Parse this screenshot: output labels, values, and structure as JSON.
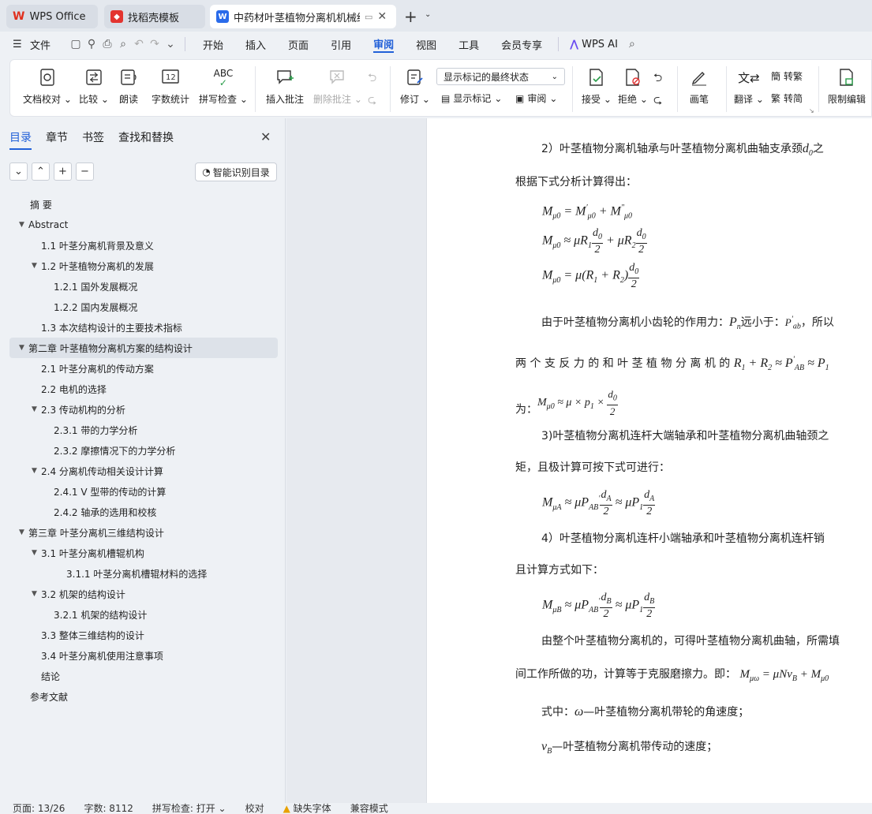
{
  "tabs": [
    {
      "label": "WPS Office"
    },
    {
      "label": "找稻壳模板"
    },
    {
      "label": "中药材叶茎植物分离机机械结构设计"
    }
  ],
  "menu": {
    "file": "文件",
    "items": [
      "开始",
      "插入",
      "页面",
      "引用",
      "审阅",
      "视图",
      "工具",
      "会员专享"
    ],
    "active": "审阅",
    "wps_ai": "WPS AI"
  },
  "ribbon": {
    "doc_proof": "文档校对",
    "compare": "比较",
    "read_aloud": "朗读",
    "word_count": "字数统计",
    "spell_check": "拼写检查",
    "insert_comment": "插入批注",
    "delete_comment": "删除批注",
    "track": "修订",
    "markup_dropdown": "显示标记的最终状态",
    "show_markup": "显示标记",
    "review": "审阅",
    "accept": "接受",
    "reject": "拒绝",
    "pen": "画笔",
    "translate": "翻译",
    "to_traditional": "转繁",
    "to_simplified": "转简",
    "restrict_edit": "限制编辑",
    "abc": "ABC",
    "num12": "12"
  },
  "nav": {
    "tabs": [
      "目录",
      "章节",
      "书签",
      "查找和替换"
    ],
    "smart_toc": "智能识别目录",
    "toc": [
      {
        "label": "摘 要",
        "level": 1,
        "tri": ""
      },
      {
        "label": "Abstract",
        "level": 1,
        "tri": "▼"
      },
      {
        "label": "1.1 叶茎分离机背景及意义",
        "level": 2,
        "tri": ""
      },
      {
        "label": "1.2  叶茎植物分离机的发展",
        "level": 2,
        "tri": "▼"
      },
      {
        "label": "1.2.1 国外发展概况",
        "level": 3,
        "tri": ""
      },
      {
        "label": "1.2.2 国内发展概况",
        "level": 3,
        "tri": ""
      },
      {
        "label": "1.3  本次结构设计的主要技术指标",
        "level": 2,
        "tri": ""
      },
      {
        "label": "第二章  叶茎植物分离机方案的结构设计",
        "level": 1,
        "tri": "▼",
        "selected": true
      },
      {
        "label": "2.1  叶茎分离机的传动方案",
        "level": 2,
        "tri": ""
      },
      {
        "label": "2.2 电机的选择",
        "level": 2,
        "tri": ""
      },
      {
        "label": "2.3 传动机构的分析",
        "level": 2,
        "tri": "▼"
      },
      {
        "label": "2.3.1 带的力学分析",
        "level": 3,
        "tri": ""
      },
      {
        "label": "2.3.2 摩擦情况下的力学分析",
        "level": 3,
        "tri": ""
      },
      {
        "label": "2.4  分离机传动相关设计计算",
        "level": 2,
        "tri": "▼"
      },
      {
        "label": "2.4.1 V 型带的传动的计算",
        "level": 3,
        "tri": ""
      },
      {
        "label": "2.4.2  轴承的选用和校核",
        "level": 3,
        "tri": ""
      },
      {
        "label": "第三章   叶茎分离机三维结构设计",
        "level": 1,
        "tri": "▼"
      },
      {
        "label": "3.1 叶茎分离机槽辊机构",
        "level": 2,
        "tri": "▼"
      },
      {
        "label": "3.1.1 叶茎分离机槽辊材料的选择",
        "level": 4,
        "tri": ""
      },
      {
        "label": "3.2  机架的结构设计",
        "level": 2,
        "tri": "▼"
      },
      {
        "label": "3.2.1 机架的结构设计",
        "level": 3,
        "tri": ""
      },
      {
        "label": "3.3 整体三维结构的设计",
        "level": 2,
        "tri": ""
      },
      {
        "label": "3.4 叶茎分离机使用注意事项",
        "level": 2,
        "tri": ""
      },
      {
        "label": "结论",
        "level": 2,
        "tri": ""
      },
      {
        "label": "参考文献",
        "level": 1,
        "tri": ""
      }
    ]
  },
  "doc": {
    "l1": "2）叶茎植物分离机轴承与叶茎植物分离机曲轴支承颈",
    "l1b": "之",
    "l2": "根据下式分析计算得出：",
    "l3": "由于叶茎植物分离机小齿轮的作用力：",
    "l3b": "远小于：",
    "l3c": "，所以",
    "l4": "两 个 支 反 力 的 和 叶 茎 植 物 分 离 机 的",
    "l5": "为：",
    "l6": "3)叶茎植物分离机连杆大端轴承和叶茎植物分离机曲轴颈之",
    "l7": "矩，且极计算可按下式可进行：",
    "l8": "4）叶茎植物分离机连杆小端轴承和叶茎植物分离机连杆销",
    "l9": "且计算方式如下：",
    "l10": "由整个叶茎植物分离机的，可得叶茎植物分离机曲轴，所需填",
    "l11": "间工作所做的功，计算等于克服磨擦力。即：",
    "l12": "式中：",
    "l12b": "—叶茎植物分离机带轮的角速度；",
    "l13": "—叶茎植物分离机带传动的速度；"
  },
  "status": {
    "page": "页面: 13/26",
    "words": "字数: 8112",
    "spell": "拼写检查: 打开",
    "proof": "校对",
    "missing_font": "缺失字体",
    "compat": "兼容模式"
  }
}
